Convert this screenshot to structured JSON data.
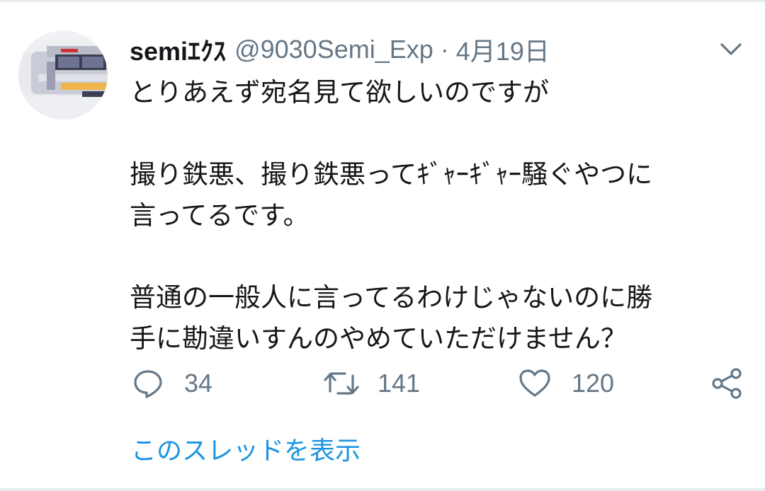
{
  "tweet": {
    "author": {
      "display_name": "semiｴｸｽ",
      "handle": "@9030Semi_Exp",
      "avatar_icon": "train-photo-avatar"
    },
    "separator": "·",
    "date": "4月19日",
    "menu_icon": "chevron-down-icon",
    "text": "とりあえず宛名見て欲しいのですが\n\n撮り鉄悪、撮り鉄悪ってｷﾞｬｰｷﾞｬｰ騒ぐやつに\n言ってるです。\n\n普通の一般人に言ってるわけじゃないのに勝\n手に勘違いすんのやめていただけません？",
    "actions": {
      "reply": {
        "icon": "reply-bubble-icon",
        "count": "34"
      },
      "retweet": {
        "icon": "retweet-icon",
        "count": "141"
      },
      "like": {
        "icon": "heart-icon",
        "count": "120"
      },
      "share": {
        "icon": "share-icon"
      }
    },
    "show_thread_label": "このスレッドを表示"
  },
  "colors": {
    "text_primary": "#14171a",
    "text_secondary": "#657786",
    "link": "#1b95e0",
    "divider": "#e6ecf0"
  }
}
